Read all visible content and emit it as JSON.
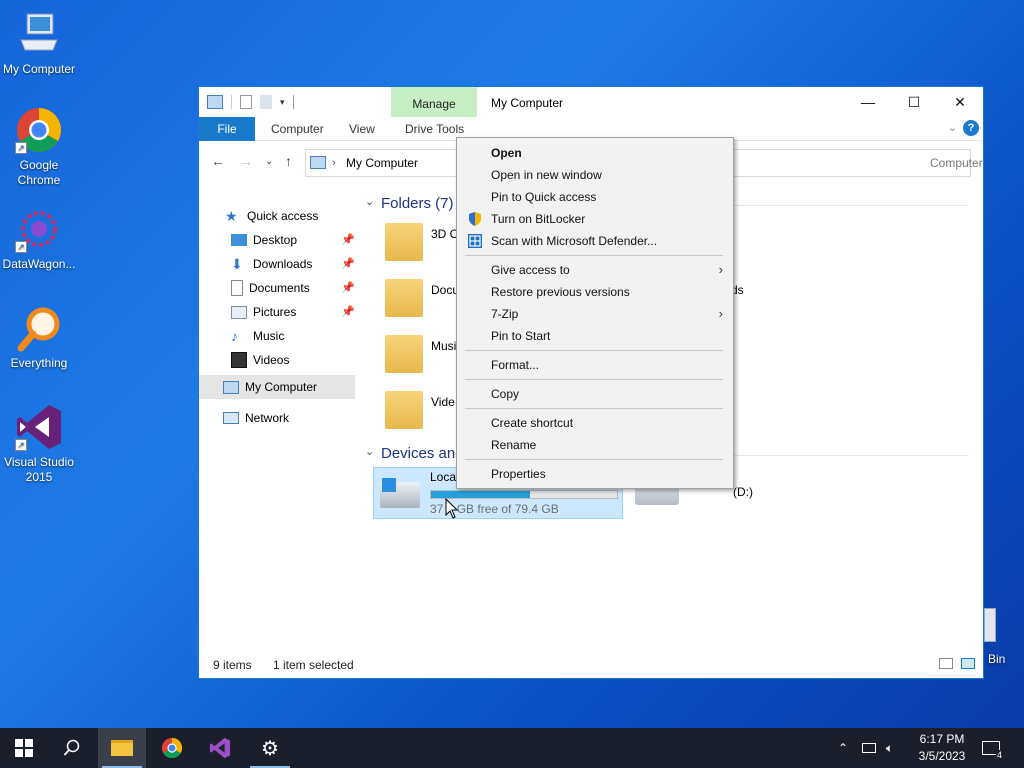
{
  "desktop": {
    "icons": [
      {
        "label": "My Computer"
      },
      {
        "label": "Google Chrome"
      },
      {
        "label": "DataWagon..."
      },
      {
        "label": "Everything"
      },
      {
        "label": "Visual Studio 2015"
      }
    ],
    "recycle_bin_partial": "Bin"
  },
  "window": {
    "title": "My Computer",
    "manage_tab": "Manage",
    "ribbon_tabs": [
      "File",
      "Computer",
      "View",
      "Drive Tools"
    ],
    "address_text": "My Computer",
    "search_partial": "Computer"
  },
  "nav": {
    "quick_access": "Quick access",
    "items": [
      {
        "label": "Desktop",
        "pinned": true
      },
      {
        "label": "Downloads",
        "pinned": true
      },
      {
        "label": "Documents",
        "pinned": true
      },
      {
        "label": "Pictures",
        "pinned": true
      },
      {
        "label": "Music",
        "pinned": false
      },
      {
        "label": "Videos",
        "pinned": false
      }
    ],
    "my_computer": "My Computer",
    "network": "Network"
  },
  "content": {
    "folders_header": "Folders (7)",
    "folders": [
      {
        "label": "3D O"
      },
      {
        "label": "Docu"
      },
      {
        "label": "Musi"
      },
      {
        "label": "Vide"
      }
    ],
    "folder_right_partial": "ds",
    "devices_header": "Devices and",
    "drive_c": {
      "label": "Loca",
      "free_text": "37",
      "free_rest": "GB free of 79.4 GB",
      "used_fraction": 0.53
    },
    "drive_d_partial": "(D:)"
  },
  "status": {
    "items": "9 items",
    "selected": "1 item selected"
  },
  "context_menu": {
    "items": [
      {
        "label": "Open",
        "bold": true
      },
      {
        "label": "Open in new window"
      },
      {
        "label": "Pin to Quick access"
      },
      {
        "label": "Turn on BitLocker",
        "icon": "shield-icon"
      },
      {
        "label": "Scan with Microsoft Defender...",
        "icon": "defender-icon"
      },
      {
        "label": "Give access to",
        "submenu": true
      },
      {
        "label": "Restore previous versions"
      },
      {
        "label": "7-Zip",
        "submenu": true
      },
      {
        "label": "Pin to Start"
      },
      {
        "label": "Format..."
      },
      {
        "label": "Copy"
      },
      {
        "label": "Create shortcut"
      },
      {
        "label": "Rename"
      },
      {
        "label": "Properties"
      }
    ]
  },
  "taskbar": {
    "time": "6:17 PM",
    "date": "3/5/2023",
    "notification_count": "4"
  },
  "colors": {
    "accent": "#1979ca",
    "manage_tab": "#c6eec4",
    "selection": "#cce8ff",
    "drive_fill": "#26a0da",
    "taskbar": "#1a1f2b"
  }
}
